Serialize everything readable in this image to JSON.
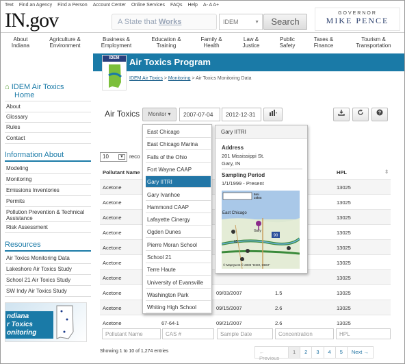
{
  "top_links": [
    "Text",
    "Find an Agency",
    "Find a Person",
    "Account Center",
    "Online Services",
    "FAQs",
    "Help",
    "A- A A+"
  ],
  "logo": "IN.gov",
  "search": {
    "slogan_prefix": "A State that ",
    "slogan_emph": "Works",
    "agency": "IDEM",
    "button": "Search"
  },
  "governor": {
    "title": "GOVERNOR",
    "name": "MIKE PENCE"
  },
  "nav": [
    {
      "l1": "About",
      "l2": "Indiana"
    },
    {
      "l1": "Agriculture &",
      "l2": "Environment"
    },
    {
      "l1": "Business &",
      "l2": "Employment"
    },
    {
      "l1": "Education &",
      "l2": "Training"
    },
    {
      "l1": "Family &",
      "l2": "Health"
    },
    {
      "l1": "Law &",
      "l2": "Justice"
    },
    {
      "l1": "Public",
      "l2": "Safety"
    },
    {
      "l1": "Taxes &",
      "l2": "Finance"
    },
    {
      "l1": "Tourism &",
      "l2": "Transportation"
    }
  ],
  "banner": {
    "title": "Air Toxics Program",
    "logo_text": "IDEM"
  },
  "breadcrumb": {
    "c1": "IDEM Air Toxics",
    "sep1": " > ",
    "c2": "Monitoring",
    "sep2": " > ",
    "c3": "Air Toxics Monitoring Data"
  },
  "sidebar": {
    "home_l1": "IDEM Air Toxics",
    "home_l2": "Home",
    "links1": [
      "About",
      "Glossary",
      "Rules",
      "Contact"
    ],
    "info_head": "Information About",
    "links2": [
      "Modeling",
      "Monitoring",
      "Emissions Inventories",
      "Permits",
      "Pollution Prevention & Technical Assistance",
      "Risk Assessment"
    ],
    "res_head": "Resources",
    "links3": [
      "Air Toxics Monitoring Data",
      "Lakeshore Air Toxics Study",
      "School 21 Air Toxics Study",
      "SW Indy Air Toxics Study"
    ],
    "art_l1": "ndiana",
    "art_l2": "r Toxics",
    "art_l3": "onitoring"
  },
  "toolbar": {
    "title": "Air Toxics",
    "monitor": "Monitor",
    "start": "2007-07-04",
    "end": "2012-12-31",
    "chart_icon": "bar-chart-icon",
    "download_icon": "download-icon",
    "refresh_icon": "refresh-icon",
    "help_icon": "help-icon"
  },
  "table": {
    "page_len": "10",
    "len_label": "reco",
    "col_pollutant": "Pollutant Name",
    "col_hpl": "HPL",
    "rows": [
      {
        "pollutant": "Acetone",
        "cas": "",
        "date": "",
        "conc": "",
        "hpl": "13025"
      },
      {
        "pollutant": "Acetone",
        "cas": "",
        "date": "",
        "conc": "",
        "hpl": "13025"
      },
      {
        "pollutant": "Acetone",
        "cas": "",
        "date": "",
        "conc": "",
        "hpl": "13025"
      },
      {
        "pollutant": "Acetone",
        "cas": "",
        "date": "",
        "conc": "",
        "hpl": "13025"
      },
      {
        "pollutant": "Acetone",
        "cas": "",
        "date": "",
        "conc": "",
        "hpl": "13025"
      },
      {
        "pollutant": "Acetone",
        "cas": "",
        "date": "",
        "conc": "",
        "hpl": "13025"
      },
      {
        "pollutant": "Acetone",
        "cas": "",
        "date": "",
        "conc": "",
        "hpl": "13025"
      },
      {
        "pollutant": "Acetone",
        "cas": "",
        "date": "09/03/2007",
        "conc": "1.5",
        "hpl": "13025"
      },
      {
        "pollutant": "Acetone",
        "cas": "",
        "date": "09/15/2007",
        "conc": "2.6",
        "hpl": "13025"
      },
      {
        "pollutant": "Acetone",
        "cas": "67-64-1",
        "date": "09/21/2007",
        "conc": "2.6",
        "hpl": "13025"
      }
    ],
    "filters": {
      "pollutant": "Pollutant Name",
      "cas": "CAS #",
      "date": "Sample Date",
      "conc": "Concentration",
      "hpl": "HPL"
    },
    "info": "Showing 1 to 10 of 1,274 entries",
    "pager": {
      "prev": "← Previous",
      "pages": [
        "1",
        "2",
        "3",
        "4",
        "5"
      ],
      "next": "Next →"
    }
  },
  "monitor_menu": [
    "East Chicago",
    "East Chicago Marina",
    "Falls of the Ohio",
    "Fort Wayne CAAP",
    "Gary IITRI",
    "Gary Ivanhoe",
    "Hammond CAAP",
    "Lafayette Cinergy",
    "Ogden Dunes",
    "Pierre Moran School",
    "School 21",
    "Terre Haute",
    "University of Evansville",
    "Washington Park",
    "Whiting High School"
  ],
  "monitor_selected_index": 4,
  "card": {
    "title": "Gary IITRI",
    "addr_label": "Address",
    "addr1": "201 Mississippi St.",
    "addr2": "Gary, IN",
    "period_label": "Sampling Period",
    "period": "1/1/1999 - Present",
    "map": {
      "scale1": "5mi",
      "scale2": "10km",
      "label1": "East Chicago",
      "label2": "Gary",
      "road": "90",
      "road2": "65",
      "copyright": "© MapQuest © 2008 \"DSM, ODM\""
    }
  }
}
